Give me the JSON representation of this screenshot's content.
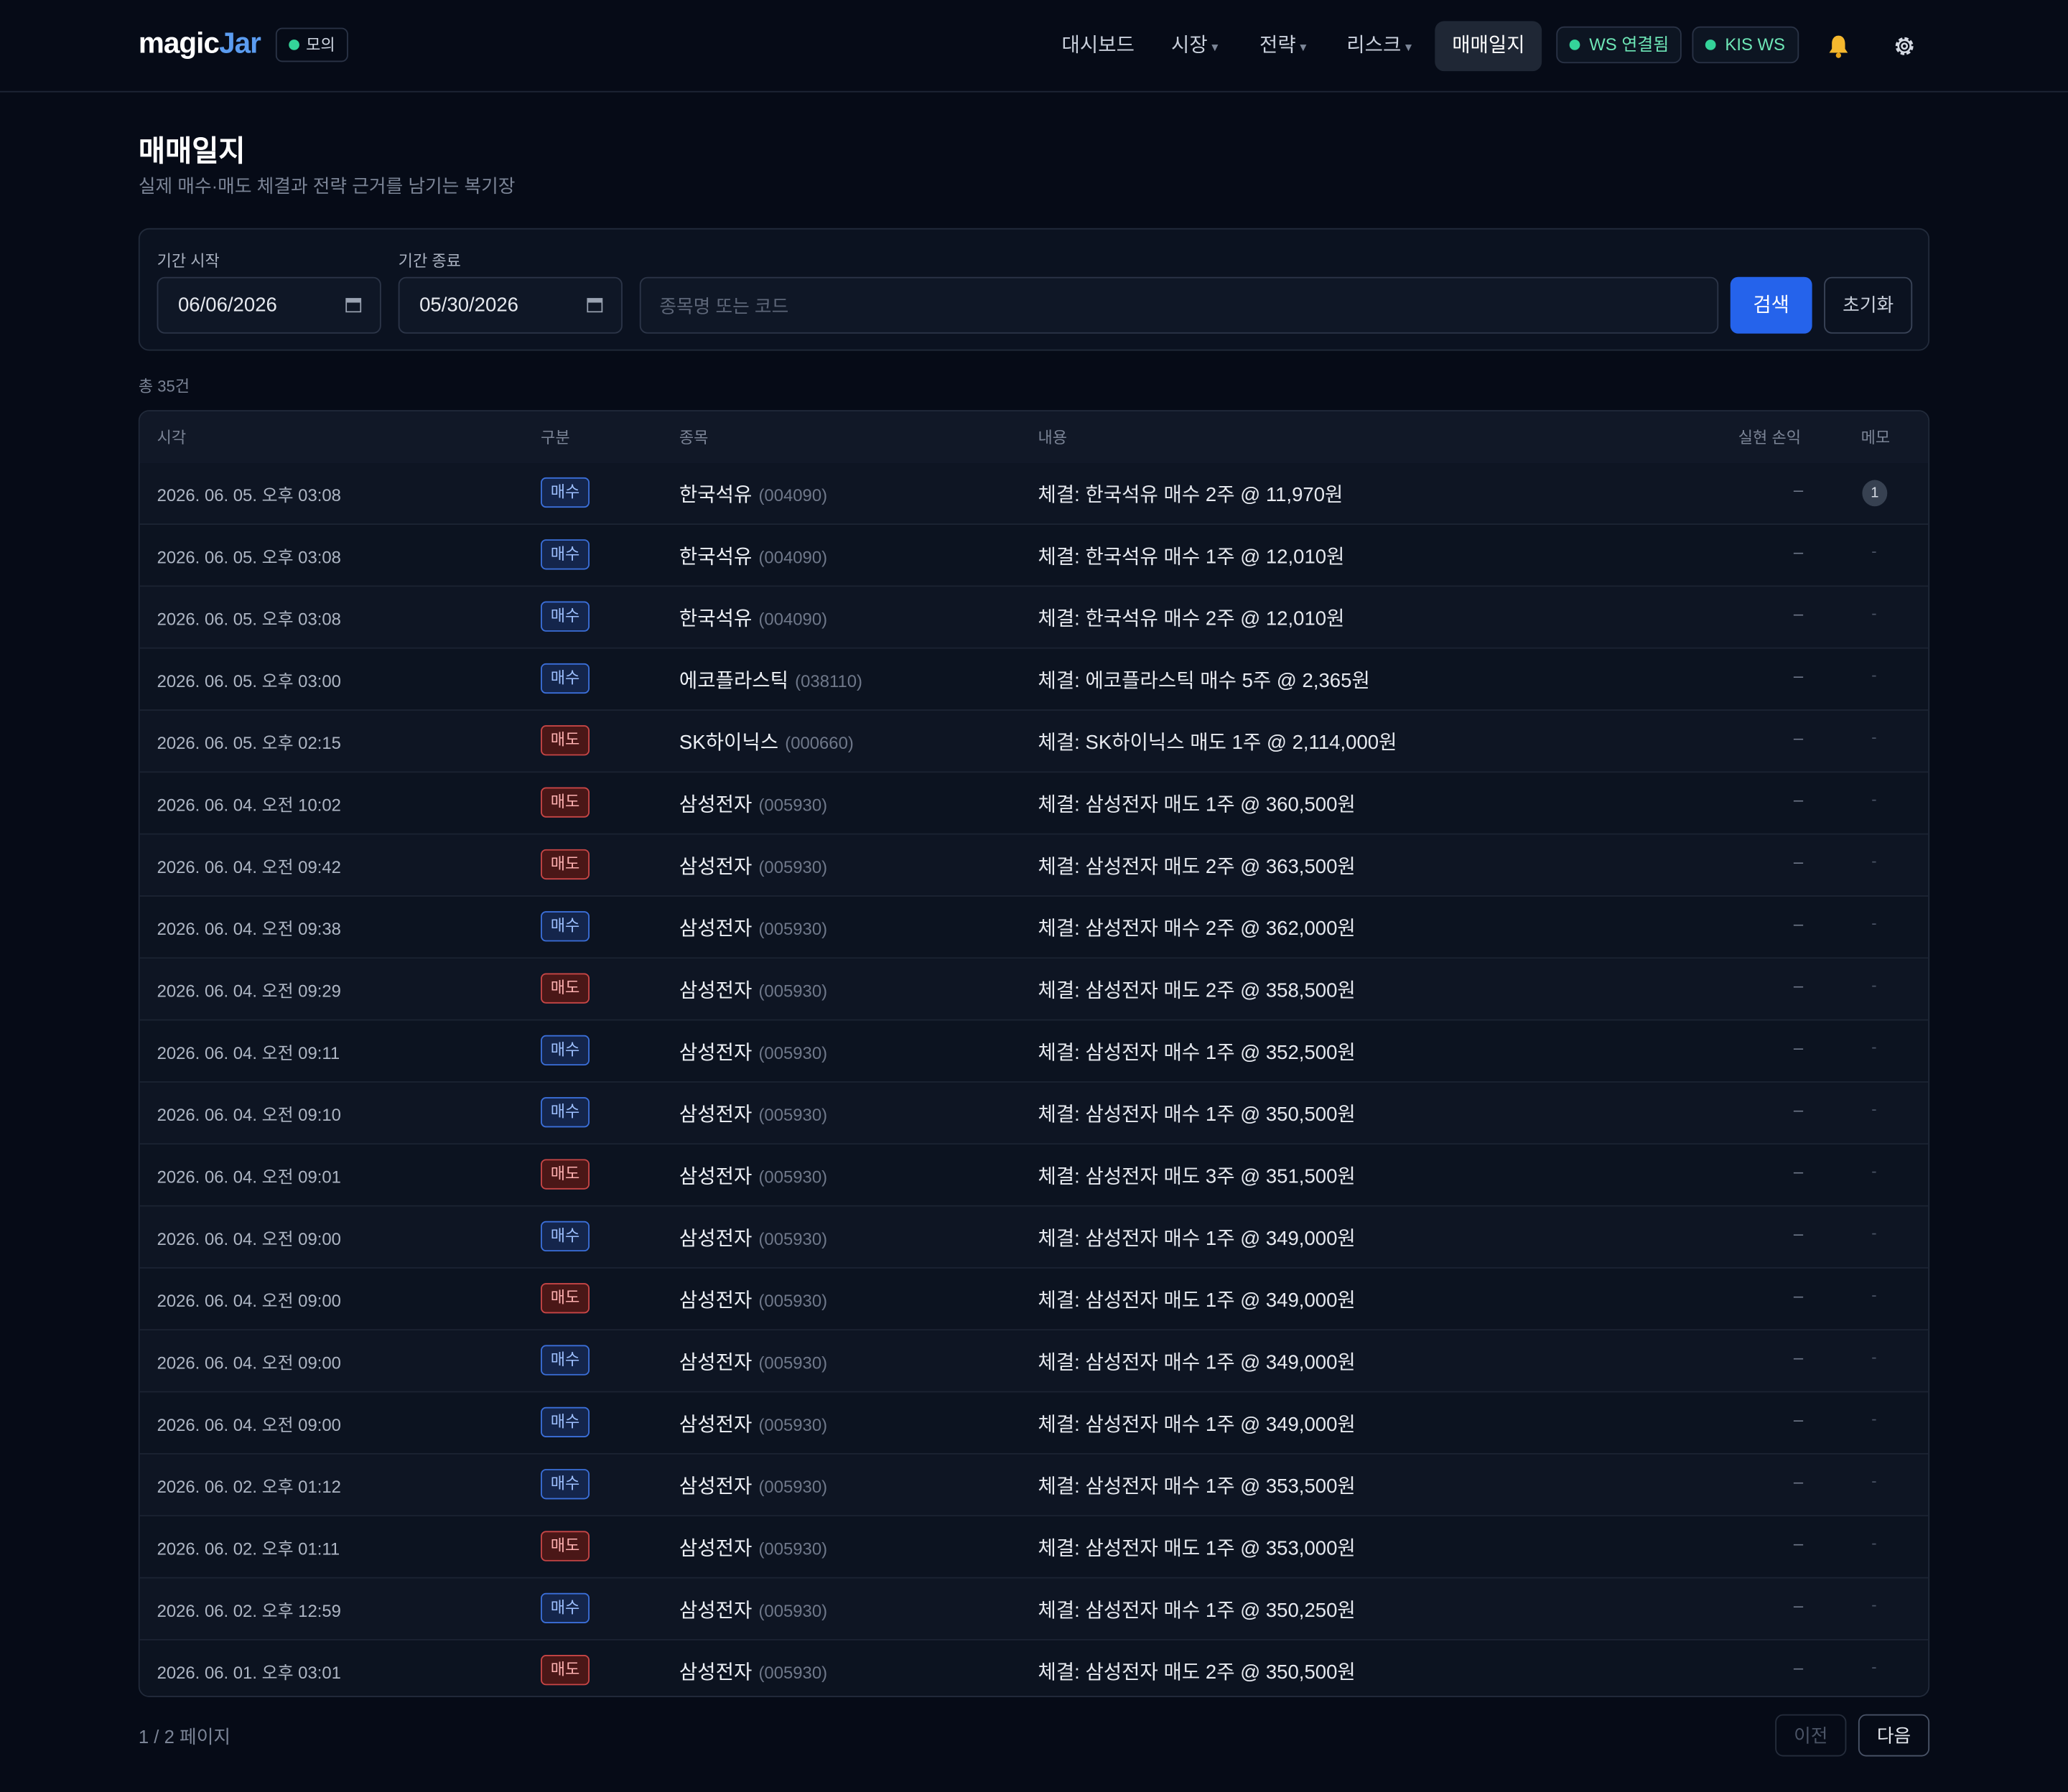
{
  "brand": {
    "part1": "magic",
    "part2": "Jar",
    "mode_badge": "모의"
  },
  "nav": {
    "dashboard": "대시보드",
    "market": "시장",
    "strategy": "전략",
    "risk": "리스크",
    "journal": "매매일지",
    "caret": "▾",
    "ws_status": "WS 연결됨",
    "kis_ws": "KIS WS"
  },
  "header": {
    "title": "매매일지",
    "subtitle": "실제 매수·매도 체결과 전략 근거를 남기는 복기장"
  },
  "filter": {
    "start_label": "기간 시작",
    "start_value": "06/06/2026",
    "end_label": "기간 종료",
    "end_value": "05/30/2026",
    "search_placeholder": "종목명 또는 코드",
    "search_button": "검색",
    "reset_button": "초기화"
  },
  "total_label": "총 35건",
  "table": {
    "columns": {
      "time": "시각",
      "side": "구분",
      "stock": "종목",
      "content": "내용",
      "pnl": "실현 손익",
      "memo": "메모"
    },
    "rows": [
      {
        "time": "2026. 06. 05. 오후 03:08",
        "side": "매수",
        "side_type": "buy",
        "stock": "한국석유",
        "code": "(004090)",
        "content": "체결: 한국석유 매수 2주 @ 11,970원",
        "pnl": "–",
        "memo": "1"
      },
      {
        "time": "2026. 06. 05. 오후 03:08",
        "side": "매수",
        "side_type": "buy",
        "stock": "한국석유",
        "code": "(004090)",
        "content": "체결: 한국석유 매수 1주 @ 12,010원",
        "pnl": "–",
        "memo": "-"
      },
      {
        "time": "2026. 06. 05. 오후 03:08",
        "side": "매수",
        "side_type": "buy",
        "stock": "한국석유",
        "code": "(004090)",
        "content": "체결: 한국석유 매수 2주 @ 12,010원",
        "pnl": "–",
        "memo": "-"
      },
      {
        "time": "2026. 06. 05. 오후 03:00",
        "side": "매수",
        "side_type": "buy",
        "stock": "에코플라스틱",
        "code": "(038110)",
        "content": "체결: 에코플라스틱 매수 5주 @ 2,365원",
        "pnl": "–",
        "memo": "-"
      },
      {
        "time": "2026. 06. 05. 오후 02:15",
        "side": "매도",
        "side_type": "sell",
        "stock": "SK하이닉스",
        "code": "(000660)",
        "content": "체결: SK하이닉스 매도 1주 @ 2,114,000원",
        "pnl": "–",
        "memo": "-"
      },
      {
        "time": "2026. 06. 04. 오전 10:02",
        "side": "매도",
        "side_type": "sell",
        "stock": "삼성전자",
        "code": "(005930)",
        "content": "체결: 삼성전자 매도 1주 @ 360,500원",
        "pnl": "–",
        "memo": "-"
      },
      {
        "time": "2026. 06. 04. 오전 09:42",
        "side": "매도",
        "side_type": "sell",
        "stock": "삼성전자",
        "code": "(005930)",
        "content": "체결: 삼성전자 매도 2주 @ 363,500원",
        "pnl": "–",
        "memo": "-"
      },
      {
        "time": "2026. 06. 04. 오전 09:38",
        "side": "매수",
        "side_type": "buy",
        "stock": "삼성전자",
        "code": "(005930)",
        "content": "체결: 삼성전자 매수 2주 @ 362,000원",
        "pnl": "–",
        "memo": "-"
      },
      {
        "time": "2026. 06. 04. 오전 09:29",
        "side": "매도",
        "side_type": "sell",
        "stock": "삼성전자",
        "code": "(005930)",
        "content": "체결: 삼성전자 매도 2주 @ 358,500원",
        "pnl": "–",
        "memo": "-"
      },
      {
        "time": "2026. 06. 04. 오전 09:11",
        "side": "매수",
        "side_type": "buy",
        "stock": "삼성전자",
        "code": "(005930)",
        "content": "체결: 삼성전자 매수 1주 @ 352,500원",
        "pnl": "–",
        "memo": "-"
      },
      {
        "time": "2026. 06. 04. 오전 09:10",
        "side": "매수",
        "side_type": "buy",
        "stock": "삼성전자",
        "code": "(005930)",
        "content": "체결: 삼성전자 매수 1주 @ 350,500원",
        "pnl": "–",
        "memo": "-"
      },
      {
        "time": "2026. 06. 04. 오전 09:01",
        "side": "매도",
        "side_type": "sell",
        "stock": "삼성전자",
        "code": "(005930)",
        "content": "체결: 삼성전자 매도 3주 @ 351,500원",
        "pnl": "–",
        "memo": "-"
      },
      {
        "time": "2026. 06. 04. 오전 09:00",
        "side": "매수",
        "side_type": "buy",
        "stock": "삼성전자",
        "code": "(005930)",
        "content": "체결: 삼성전자 매수 1주 @ 349,000원",
        "pnl": "–",
        "memo": "-"
      },
      {
        "time": "2026. 06. 04. 오전 09:00",
        "side": "매도",
        "side_type": "sell",
        "stock": "삼성전자",
        "code": "(005930)",
        "content": "체결: 삼성전자 매도 1주 @ 349,000원",
        "pnl": "–",
        "memo": "-"
      },
      {
        "time": "2026. 06. 04. 오전 09:00",
        "side": "매수",
        "side_type": "buy",
        "stock": "삼성전자",
        "code": "(005930)",
        "content": "체결: 삼성전자 매수 1주 @ 349,000원",
        "pnl": "–",
        "memo": "-"
      },
      {
        "time": "2026. 06. 04. 오전 09:00",
        "side": "매수",
        "side_type": "buy",
        "stock": "삼성전자",
        "code": "(005930)",
        "content": "체결: 삼성전자 매수 1주 @ 349,000원",
        "pnl": "–",
        "memo": "-"
      },
      {
        "time": "2026. 06. 02. 오후 01:12",
        "side": "매수",
        "side_type": "buy",
        "stock": "삼성전자",
        "code": "(005930)",
        "content": "체결: 삼성전자 매수 1주 @ 353,500원",
        "pnl": "–",
        "memo": "-"
      },
      {
        "time": "2026. 06. 02. 오후 01:11",
        "side": "매도",
        "side_type": "sell",
        "stock": "삼성전자",
        "code": "(005930)",
        "content": "체결: 삼성전자 매도 1주 @ 353,000원",
        "pnl": "–",
        "memo": "-"
      },
      {
        "time": "2026. 06. 02. 오후 12:59",
        "side": "매수",
        "side_type": "buy",
        "stock": "삼성전자",
        "code": "(005930)",
        "content": "체결: 삼성전자 매수 1주 @ 350,250원",
        "pnl": "–",
        "memo": "-"
      },
      {
        "time": "2026. 06. 01. 오후 03:01",
        "side": "매도",
        "side_type": "sell",
        "stock": "삼성전자",
        "code": "(005930)",
        "content": "체결: 삼성전자 매도 2주 @ 350,500원",
        "pnl": "–",
        "memo": "-"
      }
    ]
  },
  "pagination": {
    "info": "1 / 2 페이지",
    "prev": "이전",
    "next": "다음"
  },
  "colors": {
    "accent": "#2563eb",
    "buy": "#3b6fd9",
    "sell": "#c84646",
    "online": "#34d399"
  },
  "icons": {
    "notification": "bell-icon",
    "settings": "gear-icon",
    "date": "calendar-icon"
  }
}
